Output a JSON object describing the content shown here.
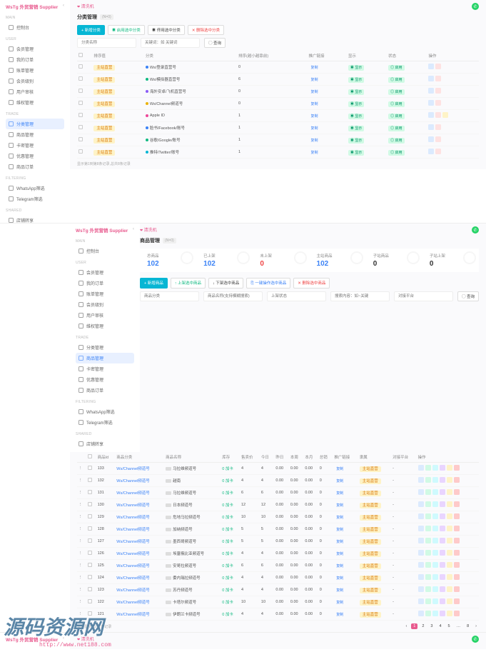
{
  "brand": "WsTg 外贸营销 Supplier",
  "whatsapp_icon": "wa",
  "sideGroups": {
    "main": "MAIN",
    "user": "USER",
    "trade": "TRADE",
    "filtering": "FILTERING",
    "shared": "SHARED"
  },
  "sideItems": {
    "dashboard": "控制台",
    "memberManage": "会员管理",
    "myOrders": "我的订单",
    "walletManage": "账单管理",
    "memberLevel": "会员级别",
    "userReview": "用户审核",
    "complaint": "维权管理",
    "categoryManage": "分类管理",
    "productManage": "商品管理",
    "cardManage": "卡密管理",
    "couponManage": "优惠管理",
    "productOrders": "商品订单",
    "whatsappFilter": "WhatsApp筛选",
    "telegramFilter": "Telegram筛选",
    "shopShare": "店铺转享"
  },
  "crumb1": "清洗机",
  "page1": {
    "title": "分类管理",
    "count": "(N=0)",
    "toolbar": {
      "add": "+ 新增分类",
      "enable": "◉ 启用选中分类",
      "disable": "◉ 停用选中分类",
      "delete": "✕ 删除选中分类"
    },
    "filters": {
      "category": "分类名称",
      "keyword": "关键词：如 关键词",
      "search": "◯ 查询"
    },
    "head": {
      "check": "",
      "id": "排序值",
      "cat": "分类",
      "desc": "排序(越小越靠前)",
      "promo": "推广链接",
      "show": "显示",
      "status": "状态",
      "ops": "操作"
    },
    "rows": [
      {
        "id": "0",
        "cat": "主站直营",
        "icon": "blue",
        "name": "Ws/登录直营号",
        "sort": "0",
        "promo": "复制",
        "show": "◉ 显示",
        "status": "◎ 启用",
        "ops": [
          "edit",
          "del"
        ]
      },
      {
        "id": "0",
        "cat": "主站直营",
        "icon": "green",
        "name": "Ws/模拟器直营号",
        "sort": "6",
        "promo": "复制",
        "show": "◉ 显示",
        "status": "◎ 启用",
        "ops": [
          "edit",
          "del"
        ]
      },
      {
        "id": "0",
        "cat": "主站直营",
        "icon": "purple",
        "name": "海外安卓/飞机直营号",
        "sort": "0",
        "promo": "复制",
        "show": "◉ 显示",
        "status": "◎ 启用",
        "ops": [
          "edit",
          "del"
        ]
      },
      {
        "id": "0",
        "cat": "主站直营",
        "icon": "yellow",
        "name": "Ws/Channel频道号",
        "sort": "0",
        "promo": "复制",
        "show": "◉ 显示",
        "status": "◎ 启用",
        "ops": [
          "edit",
          "del"
        ]
      },
      {
        "id": "0",
        "cat": "主站直营",
        "icon": "pink",
        "name": "Apple ID",
        "sort": "1",
        "promo": "复制",
        "show": "◉ 显示",
        "status": "◎ 启用",
        "ops": [
          "edit",
          "del",
          "move"
        ]
      },
      {
        "id": "0",
        "cat": "主站直营",
        "icon": "blue",
        "name": "脸书/Facebook/账号",
        "sort": "1",
        "promo": "复制",
        "show": "◉ 显示",
        "status": "◎ 启用",
        "ops": [
          "edit",
          "del"
        ]
      },
      {
        "id": "0",
        "cat": "主站直营",
        "icon": "green",
        "name": "谷歌/Google/账号",
        "sort": "1",
        "promo": "复制",
        "show": "◉ 显示",
        "status": "◎ 启用",
        "ops": [
          "edit",
          "del"
        ]
      },
      {
        "id": "0",
        "cat": "主站直营",
        "icon": "cyan",
        "name": "推特/Twitter/账号",
        "sort": "1",
        "promo": "复制",
        "show": "◉ 显示",
        "status": "◎ 启用",
        "ops": [
          "edit",
          "del"
        ]
      }
    ],
    "footer": "显示第1到第8条记录,总共8条记录"
  },
  "crumb2": "清洗机",
  "page2": {
    "title": "商品管理",
    "count": "(N=0)",
    "stats": {
      "total": {
        "label": "总商品",
        "value": "102"
      },
      "online": {
        "label": "已上架",
        "value": "102"
      },
      "offline": {
        "label": "未上架",
        "value": "0"
      },
      "main": {
        "label": "主站商品",
        "value": "102"
      },
      "sub": {
        "label": "子站商品",
        "value": "0"
      },
      "subOnline": {
        "label": "子站上架",
        "value": "0"
      }
    },
    "toolbar": {
      "add": "+ 新增商品",
      "up": "↑ 上架选中商品",
      "down": "↓ 下架选中商品",
      "clone": "⎘ 一键操作选中商品",
      "delete": "✕ 删除选中商品"
    },
    "filters": {
      "category": "商品分类",
      "name": "商品名称(支持模糊搜索)",
      "status": "上架状态",
      "keyword": "搜索内容：如~关键",
      "platform": "对接平台",
      "search": "◯ 查询"
    },
    "head": {
      "drag": "",
      "chk": "",
      "id": "商品Id",
      "cat": "商品分类",
      "name": "商品名称",
      "stock": "库存",
      "sellprice": "售卖价",
      "today": "今日",
      "yesterday": "昨日",
      "week": "本周",
      "month": "本月",
      "total": "总销",
      "promo": "推广链接",
      "ref": "隶属",
      "platform": "对接平台",
      "ops": "操作"
    },
    "rows": [
      {
        "id": "133",
        "cat": "Ws/Channel频道号",
        "name": "马拉维频道号",
        "stock": "0 加卡",
        "price": "4",
        "t": "4",
        "y": "0.00",
        "w": "0.00",
        "m": "0.00",
        "tot": "0",
        "promo": "复制",
        "ref": "主站直营",
        "plat": "-"
      },
      {
        "id": "132",
        "cat": "Ws/Channel频道号",
        "name": "越南",
        "stock": "0 加卡",
        "price": "4",
        "t": "4",
        "y": "0.00",
        "w": "0.00",
        "m": "0.00",
        "tot": "0",
        "promo": "复制",
        "ref": "主站直营",
        "plat": "-"
      },
      {
        "id": "131",
        "cat": "Ws/Channel频道号",
        "name": "马拉维频道号",
        "stock": "0 加卡",
        "price": "6",
        "t": "6",
        "y": "0.00",
        "w": "0.00",
        "m": "0.00",
        "tot": "0",
        "promo": "复制",
        "ref": "主站直营",
        "plat": "-"
      },
      {
        "id": "130",
        "cat": "Ws/Channel频道号",
        "name": "日本频道号",
        "stock": "0 加卡",
        "price": "12",
        "t": "12",
        "y": "0.00",
        "w": "0.00",
        "m": "0.00",
        "tot": "0",
        "promo": "复制",
        "ref": "主站直营",
        "plat": "-"
      },
      {
        "id": "129",
        "cat": "Ws/Channel频道号",
        "name": "危地马拉频道号",
        "stock": "0 加卡",
        "price": "10",
        "t": "10",
        "y": "0.00",
        "w": "0.00",
        "m": "0.00",
        "tot": "0",
        "promo": "复制",
        "ref": "主站直营",
        "plat": "-"
      },
      {
        "id": "128",
        "cat": "Ws/Channel频道号",
        "name": "加纳频道号",
        "stock": "0 加卡",
        "price": "5",
        "t": "5",
        "y": "0.00",
        "w": "0.00",
        "m": "0.00",
        "tot": "0",
        "promo": "复制",
        "ref": "主站直营",
        "plat": "-"
      },
      {
        "id": "127",
        "cat": "Ws/Channel频道号",
        "name": "墨西哥频道号",
        "stock": "0 加卡",
        "price": "5",
        "t": "5",
        "y": "0.00",
        "w": "0.00",
        "m": "0.00",
        "tot": "0",
        "promo": "复制",
        "ref": "主站直营",
        "plat": "-"
      },
      {
        "id": "126",
        "cat": "Ws/Channel频道号",
        "name": "埃塞俄比亚频道号",
        "stock": "0 加卡",
        "price": "4",
        "t": "4",
        "y": "0.00",
        "w": "0.00",
        "m": "0.00",
        "tot": "0",
        "promo": "复制",
        "ref": "主站直营",
        "plat": "-"
      },
      {
        "id": "125",
        "cat": "Ws/Channel频道号",
        "name": "安哥拉频道号",
        "stock": "0 加卡",
        "price": "6",
        "t": "6",
        "y": "0.00",
        "w": "0.00",
        "m": "0.00",
        "tot": "0",
        "promo": "复制",
        "ref": "主站直营",
        "plat": "-"
      },
      {
        "id": "124",
        "cat": "Ws/Channel频道号",
        "name": "委内瑞拉频道号",
        "stock": "0 加卡",
        "price": "4",
        "t": "4",
        "y": "0.00",
        "w": "0.00",
        "m": "0.00",
        "tot": "0",
        "promo": "复制",
        "ref": "主站直营",
        "plat": "-"
      },
      {
        "id": "123",
        "cat": "Ws/Channel频道号",
        "name": "苏丹频道号",
        "stock": "0 加卡",
        "price": "4",
        "t": "4",
        "y": "0.00",
        "w": "0.00",
        "m": "0.00",
        "tot": "0",
        "promo": "复制",
        "ref": "主站直营",
        "plat": "-"
      },
      {
        "id": "122",
        "cat": "Ws/Channel频道号",
        "name": "卡塔尔频道号",
        "stock": "0 加卡",
        "price": "10",
        "t": "10",
        "y": "0.00",
        "w": "0.00",
        "m": "0.00",
        "tot": "0",
        "promo": "复制",
        "ref": "主站直营",
        "plat": "-"
      },
      {
        "id": "121",
        "cat": "Ws/Channel频道号",
        "name": "伊朗兰卡频道号",
        "stock": "0 加卡",
        "price": "4",
        "t": "4",
        "y": "0.00",
        "w": "0.00",
        "m": "0.00",
        "tot": "0",
        "promo": "复制",
        "ref": "主站直营",
        "plat": "-"
      }
    ],
    "footerLeft": "每页显示 15 ▲条记录",
    "pagi": [
      "‹",
      "1",
      "2",
      "3",
      "4",
      "5",
      "…",
      "8",
      "›"
    ]
  },
  "crumb3": "清洗机",
  "watermark": "源码资源网",
  "watermarkUrl": "http://www.net188.com"
}
